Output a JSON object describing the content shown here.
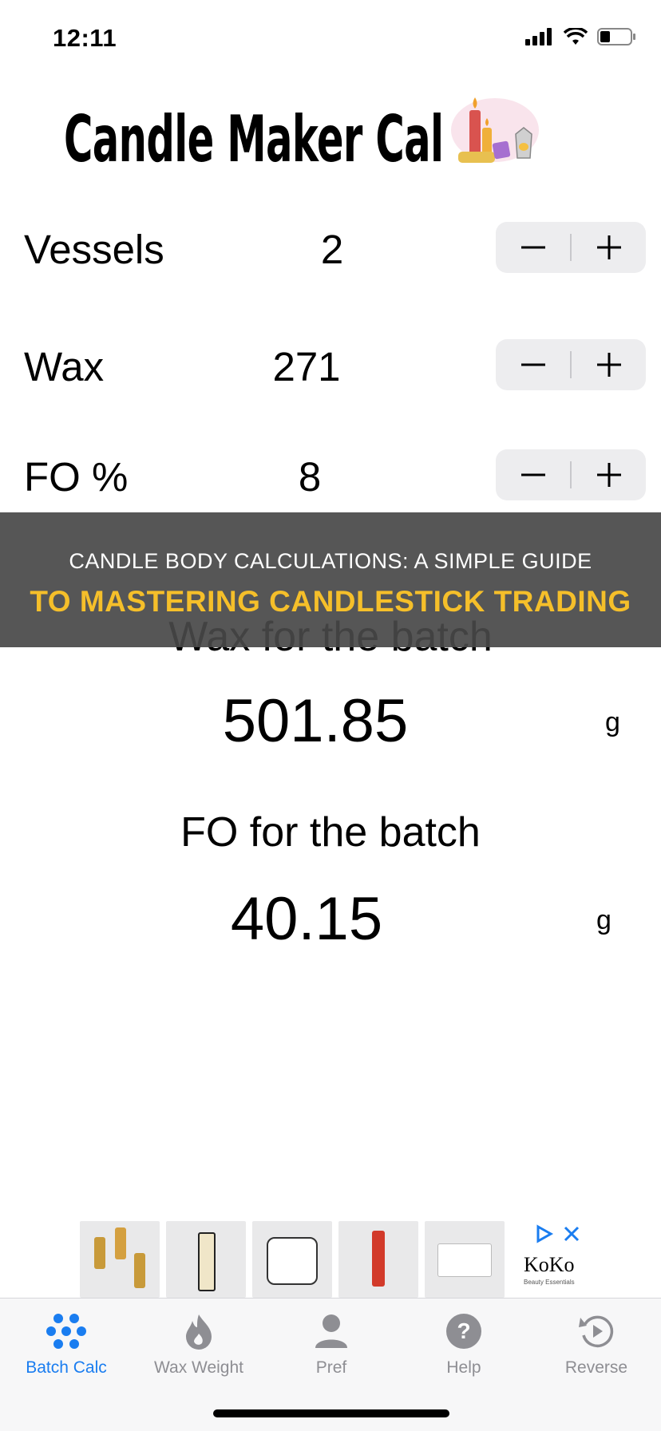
{
  "status_bar": {
    "time": "12:11"
  },
  "app": {
    "title": "Candle Maker Cal"
  },
  "rows": [
    {
      "label": "Vessels",
      "value": "2",
      "minus": "−",
      "plus": "+"
    },
    {
      "label": "Wax",
      "value": "271",
      "minus": "−",
      "plus": "+"
    },
    {
      "label": "FO %",
      "value": "8",
      "minus": "−",
      "plus": "+"
    }
  ],
  "banner": {
    "line1": "CANDLE BODY CALCULATIONS: A SIMPLE GUIDE",
    "line2": "TO MASTERING CANDLESTICK TRADING"
  },
  "results": {
    "wax_label": "Wax for the batch",
    "wax_value": "501.85",
    "wax_unit": "g",
    "fo_label": "FO for the batch",
    "fo_value": "40.15",
    "fo_unit": "g"
  },
  "ad": {
    "brand": "KoKo",
    "brand_sub": "Beauty Essentials"
  },
  "tabs": [
    {
      "label": "Batch Calc",
      "icon": "dots-grid-icon",
      "active": true
    },
    {
      "label": "Wax Weight",
      "icon": "flame-icon",
      "active": false
    },
    {
      "label": "Pref",
      "icon": "person-icon",
      "active": false
    },
    {
      "label": "Help",
      "icon": "question-icon",
      "active": false
    },
    {
      "label": "Reverse",
      "icon": "replay-icon",
      "active": false
    }
  ],
  "colors": {
    "accent": "#1a7df0",
    "banner_text": "#f5bf2a",
    "banner_bg": "#484848"
  }
}
